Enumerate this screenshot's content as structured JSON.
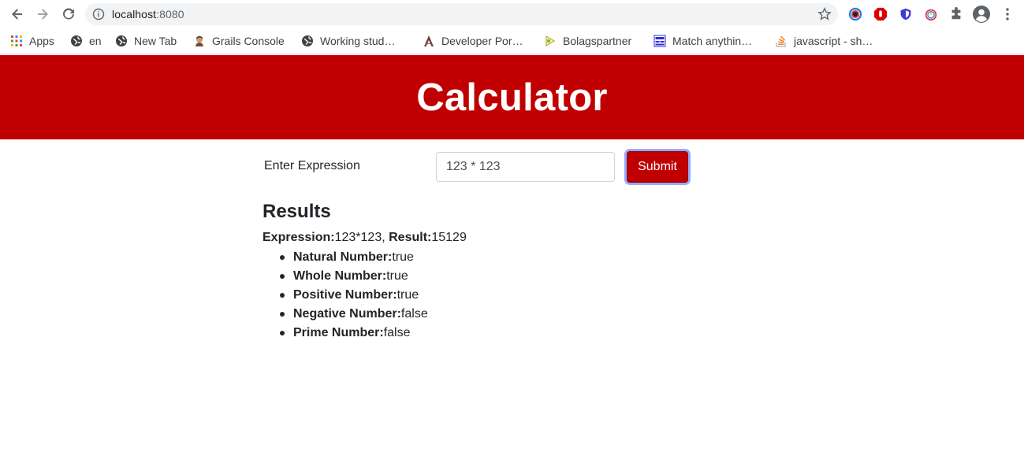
{
  "browser": {
    "url_host": "localhost",
    "url_port": ":8080",
    "bookmarks": [
      {
        "label": "Apps",
        "icon": "apps-grid-icon"
      },
      {
        "label": "en",
        "icon": "globe-icon"
      },
      {
        "label": "New Tab",
        "icon": "globe-icon"
      },
      {
        "label": "Grails Console",
        "icon": "grails-icon"
      },
      {
        "label": "Working stud…",
        "icon": "globe-icon"
      },
      {
        "label": "Developer Por…",
        "icon": "developer-portal-icon"
      },
      {
        "label": "Bolagspartner",
        "icon": "bolagspartner-icon"
      },
      {
        "label": "Match anythin…",
        "icon": "regex-icon"
      },
      {
        "label": "javascript - sh…",
        "icon": "stackoverflow-icon"
      }
    ]
  },
  "page": {
    "title": "Calculator",
    "form": {
      "label": "Enter Expression",
      "input_value": "123 * 123",
      "submit_label": "Submit"
    },
    "results": {
      "title": "Results",
      "expression_label": "Expression:",
      "expression_value": "123*123",
      "separator": ",",
      "result_label": "Result:",
      "result_value": "15129",
      "properties": [
        {
          "label": "Natural Number:",
          "value": "true"
        },
        {
          "label": "Whole Number:",
          "value": "true"
        },
        {
          "label": "Positive Number:",
          "value": "true"
        },
        {
          "label": "Negative Number:",
          "value": "false"
        },
        {
          "label": "Prime Number:",
          "value": "false"
        }
      ]
    }
  },
  "colors": {
    "brand_red": "#c00000",
    "text": "#212529"
  }
}
